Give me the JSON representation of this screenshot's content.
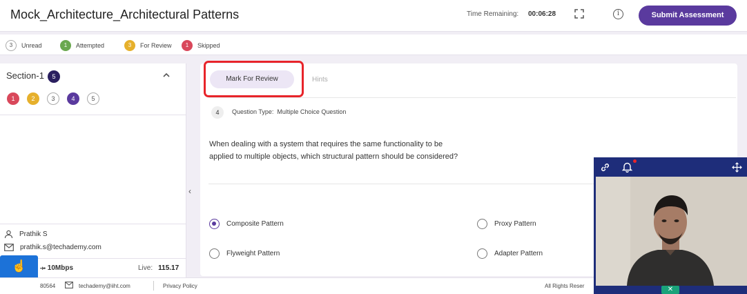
{
  "header": {
    "title": "Mock_Architecture_Architectural Patterns",
    "time_label": "Time Remaining:",
    "time_value": "00:06:28",
    "submit_label": "Submit Assessment",
    "info_glyph": "i"
  },
  "legend": {
    "items": [
      {
        "count": "3",
        "label": "Unread",
        "color": "grey"
      },
      {
        "count": "1",
        "label": "Attempted",
        "color": "#6aa84f"
      },
      {
        "count": "3",
        "label": "For Review",
        "color": "#e6b02c"
      },
      {
        "count": "1",
        "label": "Skipped",
        "color": "#d9485b"
      }
    ]
  },
  "sidebar": {
    "section_title": "Section-1",
    "section_count": "5",
    "questions": [
      "1",
      "2",
      "3",
      "4",
      "5"
    ],
    "user_name": "Prathik S",
    "user_email": "prathik.s@techademy.com",
    "speed_value": "10Mbps",
    "live_label": "Live:",
    "live_value": "115.17",
    "help_icon": "hand-pointer-icon"
  },
  "question": {
    "mark_label": "Mark For Review",
    "hints_label": "Hints",
    "number": "4",
    "type_label": "Question Type:",
    "type_value": "Multiple Choice Question",
    "text_line1": "When dealing with a system that requires the same functionality to be",
    "text_line2": "applied to multiple objects, which structural pattern should be considered?",
    "options": [
      {
        "label": "Composite Pattern",
        "selected": true
      },
      {
        "label": "Proxy Pattern",
        "selected": false
      },
      {
        "label": "Flyweight Pattern",
        "selected": false
      },
      {
        "label": "Adapter Pattern",
        "selected": false
      }
    ]
  },
  "footer": {
    "phone": "80564",
    "email": "techademy@iiht.com",
    "privacy": "Privacy Policy",
    "rights": "All Rights Reser"
  },
  "camera": {
    "close_glyph": "✕"
  },
  "colors": {
    "accent": "#5a3a9e",
    "highlight": "#e8242a",
    "camera_bar": "#1e2d7a",
    "help_button": "#1c72d8"
  }
}
